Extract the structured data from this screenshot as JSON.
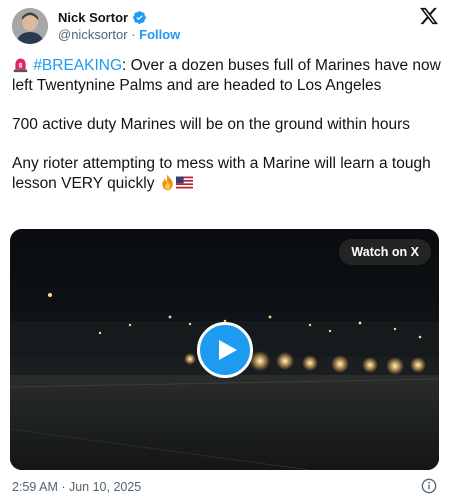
{
  "author": {
    "display_name": "Nick Sortor",
    "handle": "@nicksortor",
    "separator": "·",
    "follow_label": "Follow",
    "verified_icon": "verified-badge-icon",
    "accent": "#1d9bf0"
  },
  "tweet": {
    "emoji_siren": "siren-emoji",
    "hashtag": "#BREAKING",
    "line1_rest": ": Over a dozen buses full of Marines have now left Twentynine Palms and are headed to Los Angeles",
    "paragraph2": "700 active duty Marines will be on the ground within hours",
    "paragraph3": "Any rioter attempting to mess with a Marine will learn a tough lesson VERY quickly",
    "trailing_emojis": [
      "fire-emoji",
      "us-flag-emoji"
    ]
  },
  "media": {
    "watch_label": "Watch on X",
    "play_icon": "play-icon"
  },
  "footer": {
    "timestamp": "2:59 AM · Jun 10, 2025",
    "info_icon": "info-icon"
  },
  "brand": {
    "logo": "x-logo-icon"
  }
}
